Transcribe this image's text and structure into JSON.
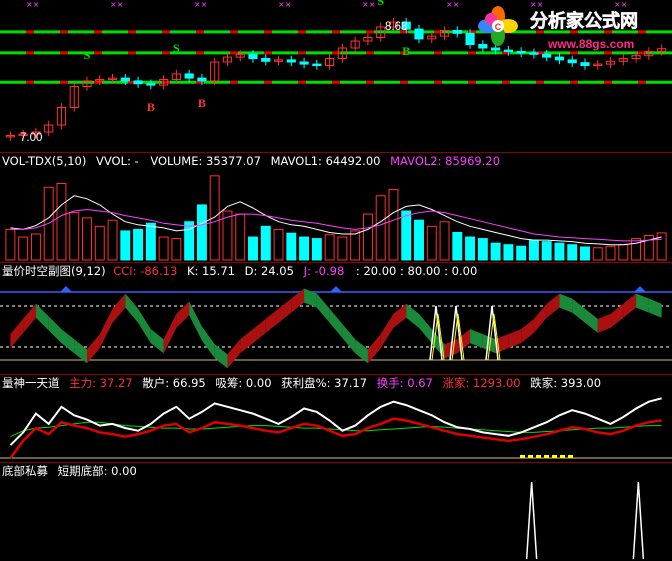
{
  "watermark": {
    "name": "分析家公式网",
    "url": "www.88gs.com"
  },
  "colors": {
    "bg": "#000000",
    "divider": "#8b0000",
    "up": "#ff3030",
    "down": "#00ffff",
    "green": "#00e000",
    "red": "#e00000",
    "white": "#ffffff",
    "yellow": "#ffff00",
    "magenta": "#ff40ff",
    "blue": "#3060ff",
    "dark_green": "#1a8a3a",
    "dark_red": "#aa1010"
  },
  "panel1": {
    "price_labels": [
      "8.68",
      "7.00"
    ],
    "markers": [
      {
        "letter": "S",
        "bar": 6,
        "color": "#00e000"
      },
      {
        "letter": "B",
        "bar": 11,
        "color": "#ff3030"
      },
      {
        "letter": "S",
        "bar": 13,
        "color": "#00e000"
      },
      {
        "letter": "B",
        "bar": 15,
        "color": "#ff3030"
      },
      {
        "letter": "S",
        "bar": 29,
        "color": "#00e000"
      },
      {
        "letter": "B",
        "bar": 31,
        "color": "#00e000"
      }
    ]
  },
  "panel2": {
    "title": "VOL-TDX(5,10)",
    "vvol": "VVOL: -",
    "volume": "VOLUME: 35377.07",
    "mavol1": "MAVOL1: 64492.00",
    "mavol2": "MAVOL2: 85969.20"
  },
  "panel3": {
    "title": "量价时空副图(9,12)",
    "cci": "CCI: -86.13",
    "k": "K: 15.71",
    "d": "D: 24.05",
    "j": "J: -0.98",
    "levels": ": 20.00 : 80.00 : 0.00"
  },
  "panel4": {
    "title": "量神一天道",
    "zhuli": "主力: 37.27",
    "sanhu": "散户: 66.95",
    "xichou": "吸筹: 0.00",
    "huolipan": "获利盘%: 37.17",
    "huanshou": "换手: 0.67",
    "zhangjia": "涨家: 1293.00",
    "diejia": "跌家: 393.00"
  },
  "panel5": {
    "title": "底部私募",
    "short_bottom": "短期底部: 0.00"
  },
  "chart_data": [
    {
      "type": "candlestick",
      "title": "",
      "price_labels": [
        8.68,
        7.0
      ],
      "closes": [
        7.0,
        7.02,
        7.05,
        7.15,
        7.4,
        7.7,
        7.78,
        7.8,
        7.82,
        7.78,
        7.74,
        7.72,
        7.8,
        7.88,
        7.82,
        7.78,
        8.05,
        8.12,
        8.16,
        8.1,
        8.06,
        8.08,
        8.05,
        8.02,
        8.0,
        8.1,
        8.25,
        8.35,
        8.4,
        8.55,
        8.62,
        8.52,
        8.38,
        8.42,
        8.5,
        8.46,
        8.3,
        8.25,
        8.22,
        8.2,
        8.18,
        8.16,
        8.12,
        8.08,
        8.04,
        8.0,
        8.02,
        8.06,
        8.1,
        8.14,
        8.2,
        8.24
      ],
      "support_lines": [
        8.48,
        8.18,
        7.76
      ],
      "notes": "S / B signal markers above/below selected bars"
    },
    {
      "type": "bar",
      "title": "VOL-TDX(5,10)",
      "series": [
        {
          "name": "VOLUME",
          "values": [
            40,
            30,
            34,
            95,
            100,
            62,
            55,
            44,
            52,
            38,
            40,
            48,
            30,
            28,
            50,
            72,
            110,
            64,
            60,
            30,
            44,
            40,
            35,
            30,
            28,
            33,
            30,
            38,
            60,
            84,
            92,
            64,
            52,
            44,
            50,
            36,
            30,
            28,
            22,
            20,
            18,
            26,
            24,
            22,
            20,
            17,
            16,
            18,
            20,
            28,
            32,
            35.38
          ]
        },
        {
          "name": "MAVOL1",
          "values": [
            42,
            40,
            45,
            55,
            72,
            84,
            80,
            72,
            60,
            50,
            46,
            44,
            42,
            38,
            40,
            48,
            56,
            70,
            76,
            68,
            58,
            50,
            46,
            44,
            40,
            36,
            34,
            34,
            40,
            50,
            62,
            70,
            72,
            66,
            58,
            50,
            44,
            40,
            36,
            32,
            28,
            26,
            26,
            25,
            24,
            22,
            21,
            20,
            20,
            22,
            26,
            30
          ]
        },
        {
          "name": "MAVOL2",
          "values": [
            40,
            40,
            42,
            48,
            58,
            64,
            66,
            64,
            62,
            58,
            55,
            52,
            48,
            46,
            44,
            46,
            50,
            56,
            60,
            60,
            58,
            55,
            52,
            50,
            48,
            45,
            42,
            40,
            42,
            46,
            52,
            58,
            62,
            64,
            62,
            58,
            54,
            50,
            46,
            42,
            38,
            34,
            32,
            30,
            29,
            28,
            27,
            26,
            25,
            25,
            26,
            27
          ]
        }
      ]
    },
    {
      "type": "area",
      "title": "量价时空副图(9,12)",
      "series": [
        {
          "name": "CCI",
          "values": [
            -40,
            20,
            80,
            30,
            -20,
            -60,
            -100,
            -40,
            60,
            120,
            60,
            -20,
            -60,
            40,
            90,
            -10,
            -80,
            -120,
            -60,
            -20,
            20,
            60,
            100,
            140,
            120,
            60,
            0,
            -60,
            -100,
            -40,
            40,
            80,
            40,
            -20,
            -80,
            -60,
            -20,
            -40,
            -60,
            -40,
            -20,
            20,
            80,
            120,
            100,
            60,
            20,
            40,
            80,
            120,
            100,
            80
          ]
        }
      ],
      "ylim": [
        0,
        100
      ],
      "levels": [
        20,
        80,
        0
      ]
    },
    {
      "type": "line",
      "title": "量神一天道",
      "series": [
        {
          "name": "主力",
          "values": [
            20,
            40,
            55,
            48,
            62,
            58,
            55,
            50,
            48,
            45,
            48,
            52,
            58,
            60,
            50,
            55,
            62,
            60,
            58,
            55,
            52,
            50,
            55,
            60,
            58,
            52,
            46,
            48,
            55,
            60,
            66,
            64,
            60,
            56,
            52,
            48,
            46,
            44,
            42,
            40,
            42,
            45,
            48,
            52,
            56,
            54,
            50,
            48,
            52,
            58,
            62,
            64
          ]
        },
        {
          "name": "散户",
          "values": [
            35,
            50,
            72,
            60,
            80,
            70,
            65,
            58,
            60,
            55,
            52,
            60,
            72,
            80,
            66,
            74,
            84,
            80,
            76,
            72,
            66,
            60,
            68,
            78,
            74,
            64,
            52,
            58,
            70,
            80,
            86,
            82,
            76,
            70,
            62,
            56,
            54,
            50,
            48,
            46,
            50,
            56,
            62,
            70,
            76,
            72,
            66,
            60,
            68,
            78,
            86,
            90
          ]
        },
        {
          "name": "获利盘%",
          "values": [
            45,
            52,
            55,
            56,
            58,
            60,
            62,
            62,
            60,
            58,
            57,
            56,
            55,
            55,
            54,
            54,
            55,
            56,
            57,
            58,
            58,
            57,
            56,
            55,
            55,
            54,
            53,
            52,
            52,
            53,
            54,
            55,
            56,
            57,
            56,
            55,
            54,
            53,
            52,
            51,
            50,
            50,
            51,
            52,
            53,
            54,
            55,
            55,
            56,
            57,
            58,
            58
          ]
        }
      ]
    },
    {
      "type": "line",
      "title": "底部私募",
      "series": [
        {
          "name": "短期底部",
          "values": [
            0,
            0,
            0,
            0,
            0,
            0,
            0,
            0,
            0,
            0,
            0,
            0,
            0,
            0,
            0,
            0,
            0,
            0,
            0,
            0,
            0,
            0,
            0,
            0,
            0,
            0,
            0,
            0,
            0,
            0,
            0,
            0,
            0,
            0,
            0,
            0,
            0,
            0,
            0,
            0,
            0,
            0,
            0,
            0,
            100,
            0,
            0,
            0,
            0,
            0,
            0,
            0,
            0,
            100,
            0,
            0
          ]
        }
      ]
    }
  ]
}
